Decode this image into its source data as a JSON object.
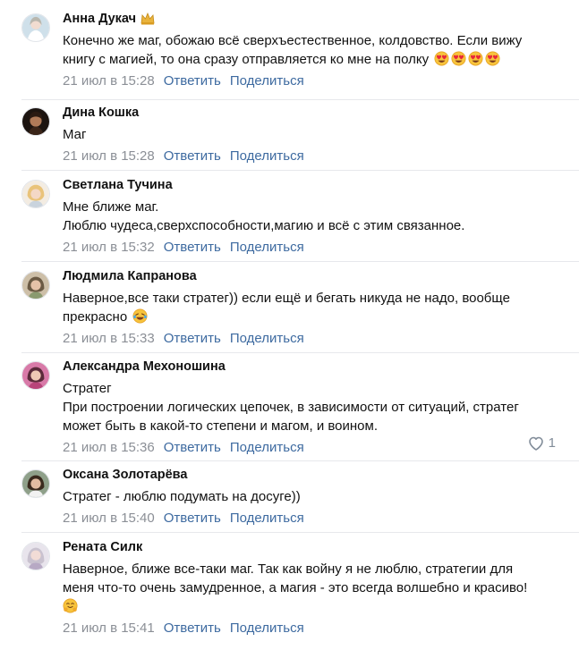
{
  "comments": [
    {
      "author": "Анна Дукач",
      "has_crown": true,
      "lines": [
        "Конечно же маг, обожаю всё сверхъестественное, колдовство. Если вижу",
        "книгу с магией, то она сразу отправляется ко мне на полку"
      ],
      "trailing_emoji": "heart-eyes-emoji x4",
      "date": "21 июл в 15:28",
      "reply": "Ответить",
      "share": "Поделиться"
    },
    {
      "author": "Дина Кошка",
      "lines": [
        "Маг"
      ],
      "date": "21 июл в 15:28",
      "reply": "Ответить",
      "share": "Поделиться"
    },
    {
      "author": "Светлана Тучина",
      "lines": [
        "Мне ближе маг.",
        "Люблю чудеса,сверхспособности,магию и всё с этим связанное."
      ],
      "date": "21 июл в 15:32",
      "reply": "Ответить",
      "share": "Поделиться"
    },
    {
      "author": "Людмила Капранова",
      "lines": [
        "Наверное,все таки стратег)) если ещё и бегать никуда не надо, вообще",
        "прекрасно"
      ],
      "trailing_emoji": "tears-of-joy-emoji",
      "date": "21 июл в 15:33",
      "reply": "Ответить",
      "share": "Поделиться"
    },
    {
      "author": "Александра Мехоношина",
      "lines": [
        "Стратег",
        "При построении логических цепочек, в зависимости от ситуаций, стратег",
        "может быть в какой-то степени и магом, и воином."
      ],
      "date": "21 июл в 15:36",
      "reply": "Ответить",
      "share": "Поделиться",
      "likes": "1"
    },
    {
      "author": "Оксана Золотарёва",
      "lines": [
        "Стратег - люблю подумать на досуге))"
      ],
      "date": "21 июл в 15:40",
      "reply": "Ответить",
      "share": "Поделиться"
    },
    {
      "author": "Рената Силк",
      "lines": [
        "Наверное, ближе все-таки маг. Так как войну я не люблю, стратегии для",
        "меня что-то очень замудренное, а магия - это всегда волшебно и красиво!"
      ],
      "trailing_emoji": "hugging-emoji",
      "date": "21 июл в 15:41",
      "reply": "Ответить",
      "share": "Поделиться"
    }
  ],
  "colors": {
    "link": "#3d6aa0",
    "meta": "#8b8f96",
    "separator": "#e7e8ec"
  }
}
